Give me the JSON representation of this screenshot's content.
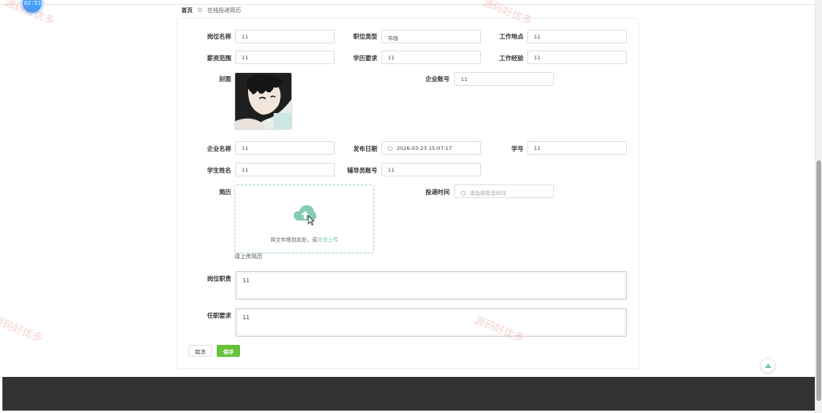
{
  "clock": "02:53",
  "breadcrumb": {
    "home": "首页",
    "separator": "☰",
    "current": "在线投递简历"
  },
  "form": {
    "position_name": {
      "label": "岗位名称",
      "value": "11"
    },
    "position_type": {
      "label": "职位类型",
      "value": "市场"
    },
    "work_location": {
      "label": "工作地点",
      "value": "11"
    },
    "salary_range": {
      "label": "薪资范围",
      "value": "11"
    },
    "education": {
      "label": "学历要求",
      "value": "11"
    },
    "work_experience": {
      "label": "工作经验",
      "value": "11"
    },
    "cover": {
      "label": "封面"
    },
    "company_account": {
      "label": "企业账号",
      "value": "11"
    },
    "company_name": {
      "label": "企业名称",
      "value": "11"
    },
    "publish_date": {
      "label": "发布日期",
      "value": "2026-03-23 15:07:17"
    },
    "student_id": {
      "label": "学号",
      "value": "11"
    },
    "student_name": {
      "label": "学生姓名",
      "value": "11"
    },
    "advisor_account": {
      "label": "辅导员账号",
      "value": "11"
    },
    "resume": {
      "label": "简历",
      "hint": "将文件拖到此处，或",
      "hint_link": "点击上传",
      "tip": "请上传简历"
    },
    "delivery_time": {
      "label": "投递时间",
      "placeholder": "请选择投递时间"
    },
    "duties": {
      "label": "岗位职责",
      "value": "11"
    },
    "requirements": {
      "label": "任职要求",
      "value": "11"
    }
  },
  "buttons": {
    "cancel": "取消",
    "save": "保存"
  },
  "watermark": "源码好优多",
  "colors": {
    "primary": "#409eff",
    "success": "#67c23a",
    "upload_accent": "#6dc7ad",
    "footer": "#333333"
  },
  "icons": {
    "clock": "clock-icon",
    "calendar": "clock-icon",
    "upload": "cloud-upload-icon",
    "scroll_top": "chevron-up-icon"
  }
}
